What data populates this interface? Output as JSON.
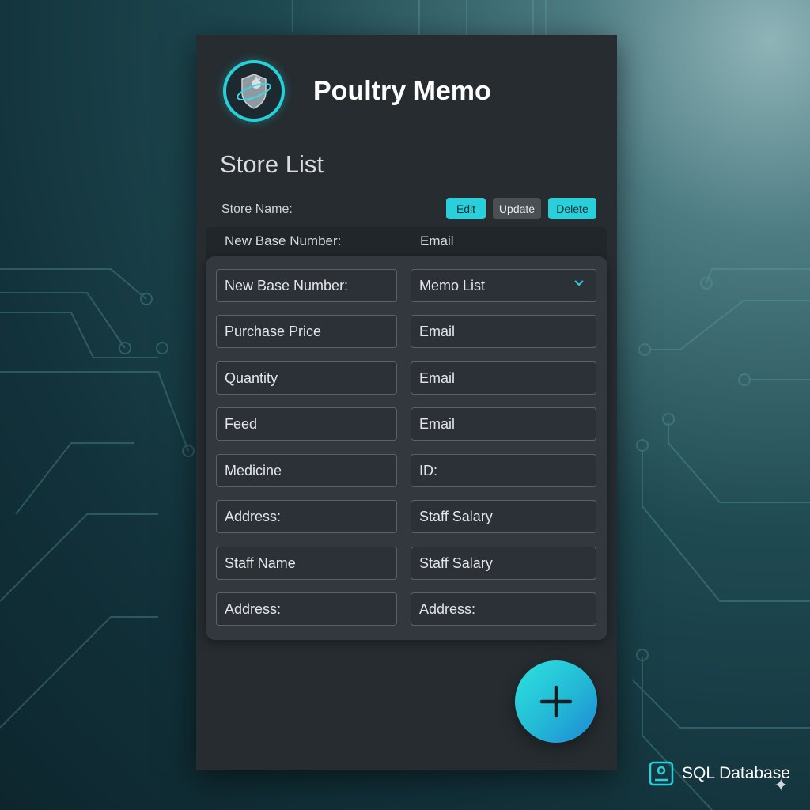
{
  "app": {
    "title": "Poultry Memo",
    "logo_icon": "rooster-shield-logo",
    "accent_color": "#29d0db"
  },
  "store_list": {
    "title": "Store List",
    "store_name_label": "Store Name:",
    "actions": {
      "edit": "Edit",
      "update": "Update",
      "delete": "Delete"
    },
    "header": {
      "left": "New Base Number:",
      "right": "Email"
    }
  },
  "form": {
    "rows": [
      {
        "left": "New Base Number:",
        "right": "Memo List"
      },
      {
        "left": "Purchase Price",
        "right": "Email"
      },
      {
        "left": "Quantity",
        "right": "Email"
      },
      {
        "left": "Feed",
        "right": "Email"
      },
      {
        "left": "Medicine",
        "right": "ID:"
      },
      {
        "left": "Address:",
        "right": "Staff Salary"
      },
      {
        "left": "Staff Name",
        "right": "Staff Salary"
      },
      {
        "left": "Address:",
        "right": "Address:"
      }
    ],
    "dropdown_icon": "chevron-down-icon"
  },
  "fab": {
    "icon": "plus-icon"
  },
  "footer_badge": {
    "icon": "database-icon",
    "label": "SQL Database"
  }
}
